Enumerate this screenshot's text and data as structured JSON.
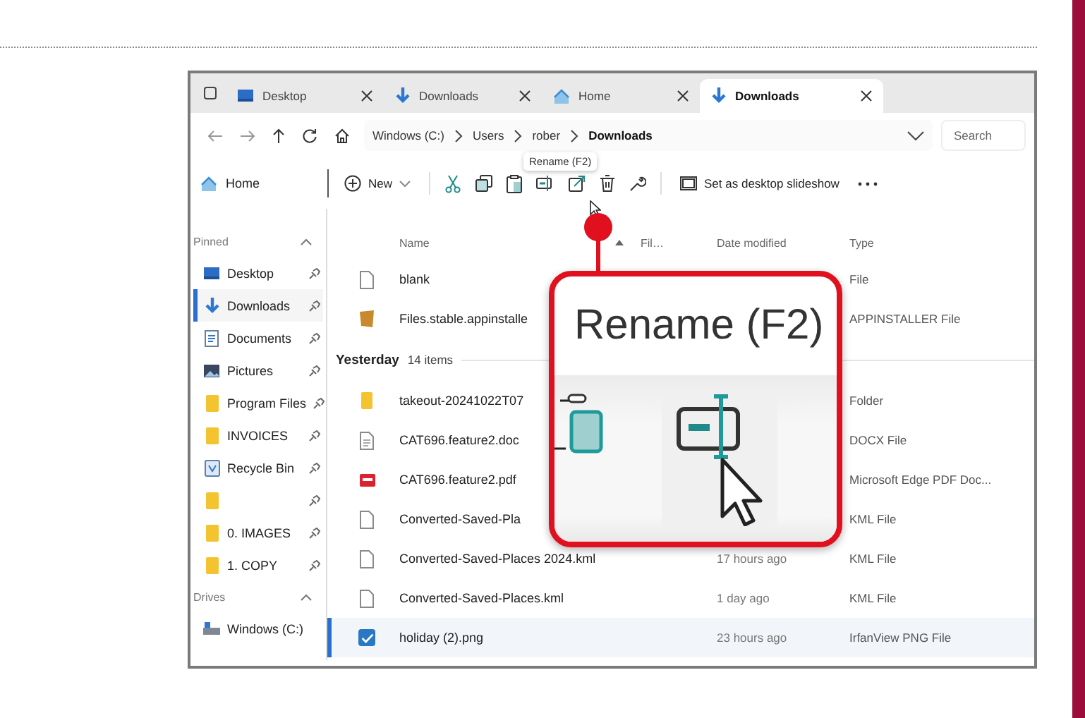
{
  "tabs": [
    {
      "label": "Desktop",
      "kind": "desktop",
      "selected": false
    },
    {
      "label": "Downloads",
      "kind": "download",
      "selected": false
    },
    {
      "label": "Home",
      "kind": "home",
      "selected": false
    },
    {
      "label": "Downloads",
      "kind": "download",
      "selected": true
    }
  ],
  "address": {
    "crumbs": [
      "Windows (C:)",
      "Users",
      "rober",
      "Downloads"
    ],
    "search_placeholder": "Search"
  },
  "tooltip": "Rename (F2)",
  "toolbar": {
    "new_label": "New",
    "slideshow_label": "Set as desktop slideshow"
  },
  "sidebar": {
    "home": "Home",
    "sections": [
      {
        "title": "Pinned",
        "expanded": true,
        "items": [
          {
            "label": "Desktop",
            "kind": "desktop",
            "pinned": true,
            "selected": false
          },
          {
            "label": "Downloads",
            "kind": "download",
            "pinned": true,
            "selected": true
          },
          {
            "label": "Documents",
            "kind": "documents",
            "pinned": true,
            "selected": false
          },
          {
            "label": "Pictures",
            "kind": "pictures",
            "pinned": true,
            "selected": false
          },
          {
            "label": "Program Files",
            "kind": "folder",
            "pinned": true,
            "selected": false
          },
          {
            "label": "INVOICES",
            "kind": "folder",
            "pinned": true,
            "selected": false
          },
          {
            "label": "Recycle Bin",
            "kind": "recycle",
            "pinned": true,
            "selected": false
          },
          {
            "kind": "folder",
            "pinned": true,
            "selected": false
          },
          {
            "label": "0. IMAGES",
            "kind": "folder",
            "pinned": true,
            "selected": false
          },
          {
            "label": "1. COPY",
            "kind": "folder",
            "pinned": true,
            "selected": false
          }
        ]
      },
      {
        "title": "Drives",
        "expanded": true,
        "items": [
          {
            "label": "Windows (C:)",
            "kind": "drive",
            "pinned": false,
            "selected": false
          }
        ]
      }
    ]
  },
  "files": {
    "columns": [
      {
        "label": "Name",
        "sorted": true
      },
      {
        "label": "Fil…",
        "sorted": false
      },
      {
        "label": "Date modified",
        "sorted": false
      },
      {
        "label": "Type",
        "sorted": false
      }
    ],
    "groups": [
      {
        "rows": [
          {
            "name": "blank",
            "type": "File",
            "kind": "file",
            "selected": false
          },
          {
            "name": "Files.stable.appinstalle",
            "type": "APPINSTALLER File",
            "kind": "package",
            "selected": false
          }
        ]
      },
      {
        "title": "Yesterday",
        "count": "14 items",
        "rows": [
          {
            "name": "takeout-20241022T07",
            "type": "Folder",
            "kind": "folder",
            "selected": false
          },
          {
            "name": "CAT696.feature2.doc",
            "type": "DOCX File",
            "kind": "document",
            "selected": false
          },
          {
            "name": "CAT696.feature2.pdf",
            "type": "Microsoft Edge PDF Doc...",
            "kind": "pdf",
            "selected": false
          },
          {
            "name": "Converted-Saved-Pla",
            "type": "KML File",
            "kind": "file",
            "selected": false
          },
          {
            "name": "Converted-Saved-Places 2024.kml",
            "date": "17 hours ago",
            "type": "KML File",
            "kind": "file",
            "selected": false
          },
          {
            "name": "Converted-Saved-Places.kml",
            "date": "1 day ago",
            "type": "KML File",
            "kind": "file",
            "selected": false
          },
          {
            "name": "holiday (2).png",
            "date": "23 hours ago",
            "type": "IrfanView PNG File",
            "selected": true
          }
        ]
      }
    ]
  },
  "callout": {
    "title": "Rename (F2)"
  }
}
